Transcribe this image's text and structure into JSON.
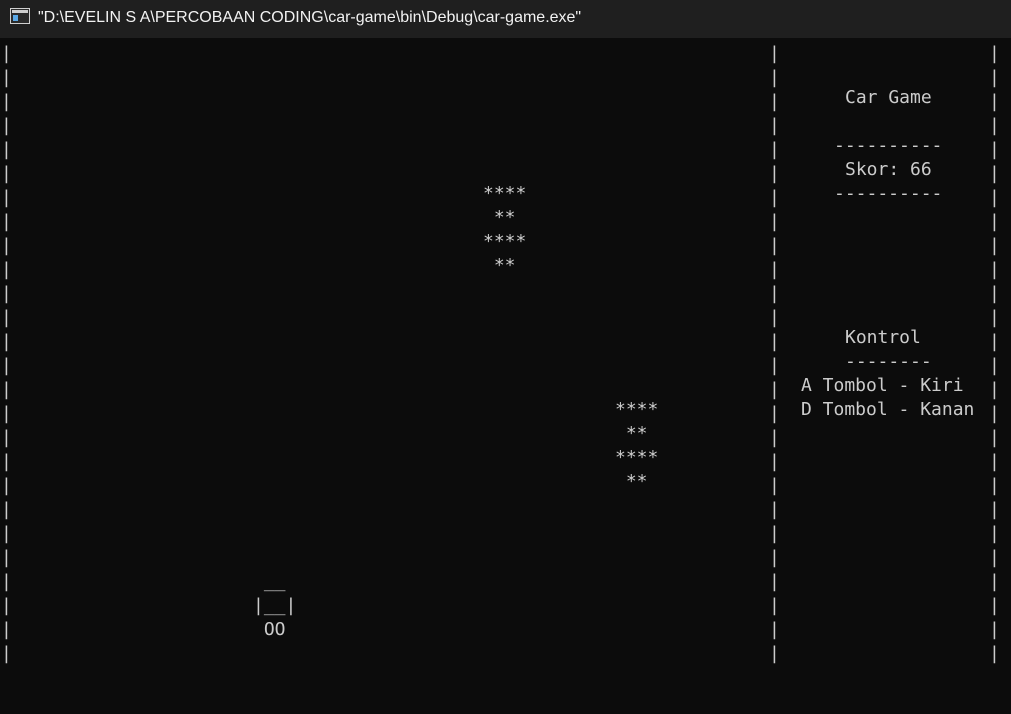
{
  "window": {
    "title": "\"D:\\EVELIN S A\\PERCOBAAN CODING\\car-game\\bin\\Debug\\car-game.exe\""
  },
  "game": {
    "border_char": "|",
    "border_rows": 26,
    "obstacles": [
      {
        "lines": [
          "****",
          " ** ",
          "****",
          " ** "
        ]
      },
      {
        "lines": [
          "****",
          " ** ",
          "****",
          " ** "
        ]
      }
    ],
    "player_car": {
      "lines": [
        " __ ",
        "|__|",
        " OO "
      ]
    }
  },
  "sidebar": {
    "title": "Car Game",
    "divider_top": "----------",
    "score_label": "Skor: 66",
    "divider_bottom": "----------",
    "controls_title": "Kontrol",
    "controls_divider": "--------",
    "control_left": "A Tombol - Kiri",
    "control_right": "D Tombol - Kanan"
  }
}
